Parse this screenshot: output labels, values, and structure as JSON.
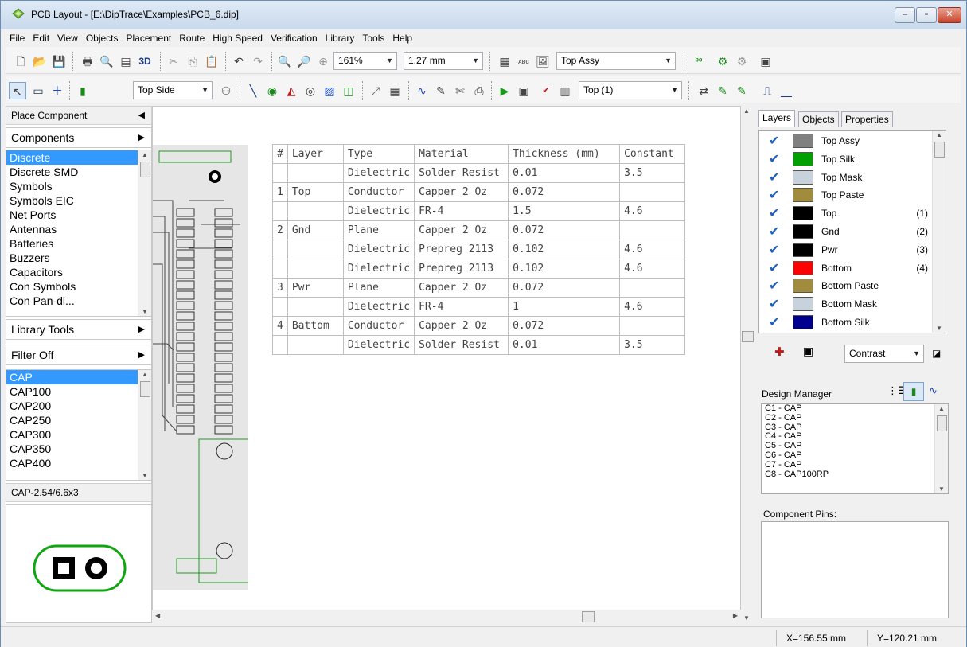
{
  "window": {
    "title": "PCB Layout - [E:\\DipTrace\\Examples\\PCB_6.dip]",
    "minimize": "–",
    "maximize": "▫",
    "close": "✕"
  },
  "menu": [
    "File",
    "Edit",
    "View",
    "Objects",
    "Placement",
    "Route",
    "High Speed",
    "Verification",
    "Library",
    "Tools",
    "Help"
  ],
  "toolbar1": {
    "zoom_value": "161%",
    "grid_value": "1.27 mm",
    "layer_view_value": "Top Assy",
    "btn_3d": "3D"
  },
  "toolbar2": {
    "side_value": "Top Side",
    "route_layer_value": "Top (1)"
  },
  "left_panel": {
    "header": "Place Component",
    "components_label": "Components",
    "libraries": [
      "Discrete",
      "Discrete SMD",
      "Symbols",
      "Symbols EIC",
      "Net Ports",
      "Antennas",
      "Batteries",
      "Buzzers",
      "Capacitors",
      "Con Symbols",
      "Con Pan-dl..."
    ],
    "selected_library": 0,
    "library_tools_label": "Library Tools",
    "filter_label": "Filter Off",
    "parts": [
      "CAP",
      "CAP100",
      "CAP200",
      "CAP250",
      "CAP300",
      "CAP350",
      "CAP400"
    ],
    "selected_part": 0,
    "pattern_name": "CAP-2.54/6.6x3"
  },
  "layer_stack": {
    "headers": [
      "#",
      "Layer",
      "Type",
      "Material",
      "Thickness (mm)",
      "Constant"
    ],
    "rows": [
      [
        "",
        "",
        "Dielectric",
        "Solder Resist",
        "0.01",
        "3.5"
      ],
      [
        "1",
        "Top",
        "Conductor",
        "Capper 2 Oz",
        "0.072",
        ""
      ],
      [
        "",
        "",
        "Dielectric",
        "FR-4",
        "1.5",
        "4.6"
      ],
      [
        "2",
        "Gnd",
        "Plane",
        "Capper 2 Oz",
        "0.072",
        ""
      ],
      [
        "",
        "",
        "Dielectric",
        "Prepreg 2113",
        "0.102",
        "4.6"
      ],
      [
        "",
        "",
        "Dielectric",
        "Prepreg 2113",
        "0.102",
        "4.6"
      ],
      [
        "3",
        "Pwr",
        "Plane",
        "Capper 2 Oz",
        "0.072",
        ""
      ],
      [
        "",
        "",
        "Dielectric",
        "FR-4",
        "1",
        "4.6"
      ],
      [
        "4",
        "Battom",
        "Conductor",
        "Capper 2 Oz",
        "0.072",
        ""
      ],
      [
        "",
        "",
        "Dielectric",
        "Solder Resist",
        "0.01",
        "3.5"
      ]
    ]
  },
  "right_panel": {
    "tabs": [
      "Layers",
      "Objects",
      "Properties"
    ],
    "active_tab": 0,
    "layers": [
      {
        "name": "Top Assy",
        "color": "#808080",
        "num": ""
      },
      {
        "name": "Top Silk",
        "color": "#00a000",
        "num": ""
      },
      {
        "name": "Top Mask",
        "color": "#c8d2dc",
        "num": ""
      },
      {
        "name": "Top Paste",
        "color": "#a08c3c",
        "num": ""
      },
      {
        "name": "Top",
        "color": "#000000",
        "num": "(1)"
      },
      {
        "name": "Gnd",
        "color": "#000000",
        "num": "(2)"
      },
      {
        "name": "Pwr",
        "color": "#000000",
        "num": "(3)"
      },
      {
        "name": "Bottom",
        "color": "#ff0000",
        "num": "(4)"
      },
      {
        "name": "Bottom Paste",
        "color": "#a08c3c",
        "num": ""
      },
      {
        "name": "Bottom Mask",
        "color": "#c8d2dc",
        "num": ""
      },
      {
        "name": "Bottom Silk",
        "color": "#000090",
        "num": ""
      }
    ],
    "view_mode_value": "Contrast",
    "design_manager_label": "Design Manager",
    "design_items": [
      "C1 - CAP",
      "C2 - CAP",
      "C3 - CAP",
      "C4 - CAP",
      "C5 - CAP",
      "C6 - CAP",
      "C7 - CAP",
      "C8 - CAP100RP"
    ],
    "component_pins_label": "Component Pins:"
  },
  "status": {
    "x": "X=156.55 mm",
    "y": "Y=120.21 mm"
  }
}
